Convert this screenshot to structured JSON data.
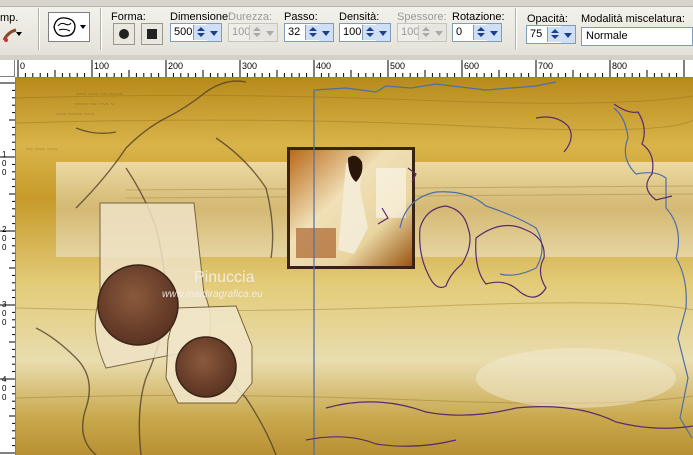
{
  "toolbar": {
    "tool_label": "mp.",
    "forma_label": "Forma:",
    "dimensione": {
      "label": "Dimensione:",
      "value": "500"
    },
    "durezza": {
      "label": "Durezza:",
      "value": "100"
    },
    "passo": {
      "label": "Passo:",
      "value": "32"
    },
    "densita": {
      "label": "Densità:",
      "value": "100"
    },
    "spessore": {
      "label": "Spessore:",
      "value": "100"
    },
    "rotazione": {
      "label": "Rotazione:",
      "value": "0"
    },
    "opacita": {
      "label": "Opacità:",
      "value": "75"
    },
    "modalita": {
      "label": "Modalità miscelatura:",
      "value": "Normale"
    }
  },
  "ruler": {
    "top_labels": [
      "0",
      "100",
      "200",
      "300",
      "400",
      "500",
      "600",
      "700",
      "800"
    ],
    "left_labels": [
      "1",
      "0",
      "0",
      "2",
      "0",
      "0",
      "3",
      "0",
      "0",
      "4",
      "0",
      "0"
    ]
  },
  "watermark": {
    "name": "Pinuccia",
    "url": "www.maidiragrafica.eu"
  },
  "colors": {
    "canvas_gold": "#c9a436",
    "selection_outline": "#4d6fa6",
    "marquee": "#5a2a6e"
  }
}
